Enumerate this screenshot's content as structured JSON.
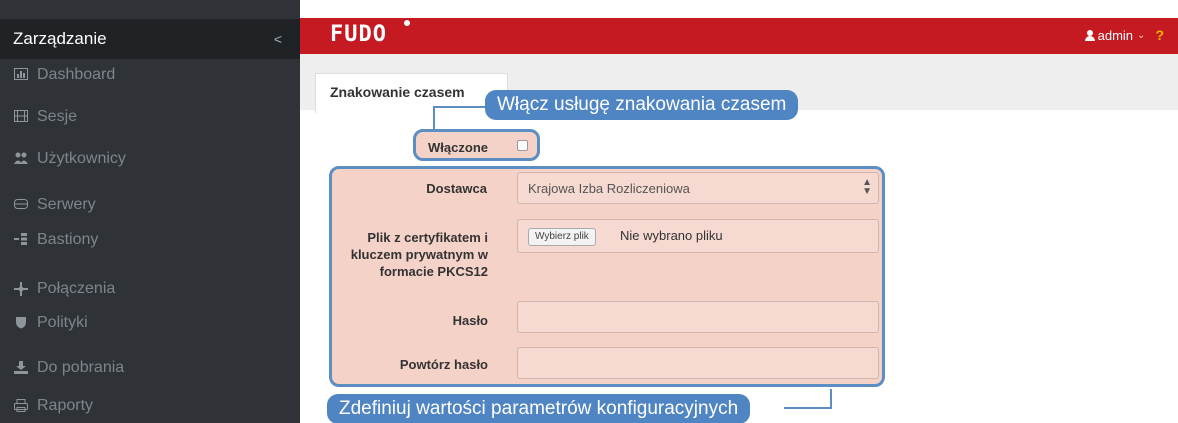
{
  "sidebar": {
    "title": "Zarządzanie",
    "collapse_icon": "chevron-left-icon",
    "items": [
      {
        "label": "Dashboard",
        "icon": "dashboard-icon"
      },
      {
        "label": "Sesje",
        "icon": "film-icon"
      },
      {
        "label": "Użytkownicy",
        "icon": "users-icon"
      },
      {
        "label": "Serwery",
        "icon": "server-icon"
      },
      {
        "label": "Bastiony",
        "icon": "bastion-icon"
      },
      {
        "label": "Połączenia",
        "icon": "connections-icon"
      },
      {
        "label": "Polityki",
        "icon": "shield-icon"
      },
      {
        "label": "Do pobrania",
        "icon": "download-icon"
      },
      {
        "label": "Raporty",
        "icon": "reports-icon"
      }
    ]
  },
  "topbar": {
    "logo": "FUDO",
    "user": "admin",
    "help": "?",
    "brand_color": "#c61a23"
  },
  "tab": {
    "label": "Znakowanie czasem"
  },
  "form": {
    "enabled_label": "Włączone",
    "provider_label": "Dostawca",
    "provider_value": "Krajowa Izba Rozliczeniowa",
    "cert_label_lines": [
      "Plik z certyfikatem i",
      "kluczem prywatnym w",
      "formacie PKCS12"
    ],
    "file_button": "Wybierz plik",
    "file_status": "Nie wybrano pliku",
    "password_label": "Hasło",
    "password_repeat_label": "Powtórz hasło"
  },
  "callouts": {
    "enable": "Włącz usługę znakowania czasem",
    "configure": "Zdefiniuj wartości parametrów konfiguracyjnych"
  },
  "colors": {
    "sidebar_bg": "#2f3337",
    "highlight_fill": "#f5d2c8",
    "callout_blue": "#4f85c2"
  }
}
